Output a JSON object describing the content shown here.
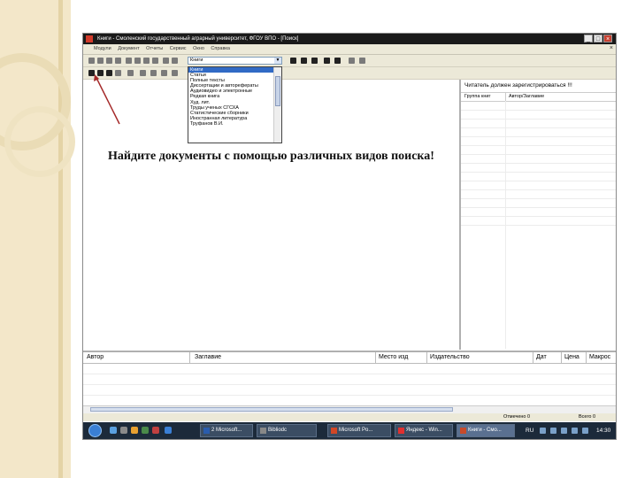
{
  "window": {
    "title": "Книги - Смоленский государственный аграрный университет, ФГОУ ВПО - [Поиск]",
    "buttons": [
      "_",
      "□",
      "×"
    ]
  },
  "menu": [
    "Модули",
    "Документ",
    "Отчеты",
    "Сервис",
    "Окно",
    "Справка"
  ],
  "search_combo": {
    "value": "Книги",
    "arrow": "▼"
  },
  "dropdown_items": [
    "Книги",
    "Статьи",
    "Полные тексты",
    "Диссертации и авторефераты",
    "Аудиовидео и электронные",
    "Редкая книга",
    "Худ. лит.",
    "Труды ученых СГСХА",
    "Статистические сборники",
    "Иностранная литература",
    "Труфанов В.И."
  ],
  "main_text": "Найдите документы с помощью различных видов поиска!",
  "right_panel": {
    "notice": "Читатель должен зарегистрироваться !!!",
    "col1": "Группа книг",
    "col2": "Автор/Заглавие"
  },
  "bottom_grid": {
    "columns": [
      "Автор",
      "Заглавие",
      "Место изд",
      "Издательство",
      "Дат",
      "Цена",
      "Макрос"
    ]
  },
  "status": {
    "left": "Отмечено 0",
    "right": "Всего 0"
  },
  "taskbar": {
    "buttons": [
      "2 Microsoft...",
      "Bibliodc",
      "Microsoft Po...",
      "Яндекс - Win...",
      "Книги - Смо..."
    ],
    "lang": "RU",
    "clock": "14:30"
  },
  "colors": {
    "accent_arrow": "#a52a2a",
    "selection": "#316ac5",
    "taskbar": "#1c2a3a"
  }
}
